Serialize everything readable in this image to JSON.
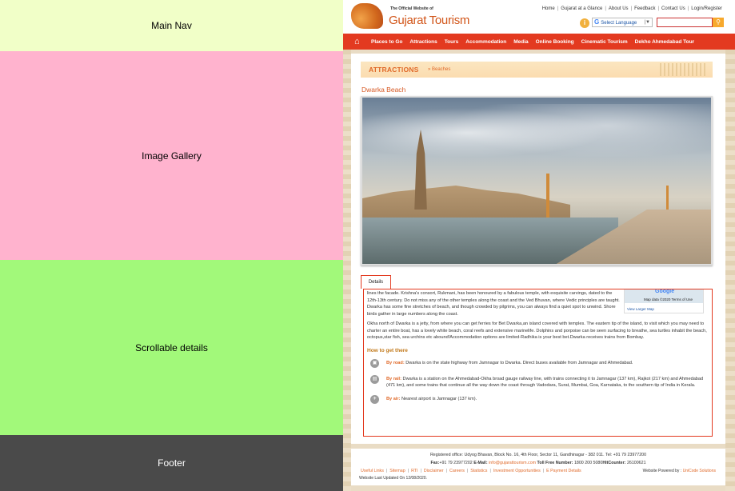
{
  "annotations": {
    "main_nav": "Main Nav",
    "image_gallery": "Image Gallery",
    "scrollable_details": "Scrollable details",
    "footer": "Footer"
  },
  "header": {
    "logo_small": "The Official Website of",
    "logo_big": "Gujarat Tourism",
    "top_links": [
      "Home",
      "Gujarat at a Glance",
      "About Us",
      "Feedback",
      "Contact Us",
      "Login/Register"
    ],
    "language_label": "Select Language",
    "search_placeholder": ""
  },
  "nav": {
    "items": [
      "Places to Go",
      "Attractions",
      "Tours",
      "Accommodation",
      "Media",
      "Online Booking",
      "Cinematic Tourism",
      "Dekho Ahmedabad Tour"
    ]
  },
  "breadcrumb": {
    "title": "ATTRACTIONS",
    "sub": "» Beaches"
  },
  "page": {
    "title": "Dwarka Beach",
    "tab": "Details"
  },
  "map": {
    "brand": "Google",
    "data_text": "Map data ©2020   Terms of Use",
    "larger_link": "View Larger Map"
  },
  "details": {
    "para1": "lines the facade. Krishna's consort, Rukmani, has been honoured by a fabulous temple, with exquisite carvings, dated to the 12th-13th century. Do not miss any of the other temples along the coast and the Ved Bhuvan, where Vedic principles are taught. Dwarka has some fine stretches of beach, and though crowded by pilgrims, you can always find a quiet spot to unwind. Shore birds gather in large numbers along the coast.",
    "para2": "Okha north of Dwarka is a jetty, from where you can get ferries for Bet Dwarka,an island covered with temples. The eastern tip of the island, to visit which you may need to charter an entire boat, has a lovely white beach, coral reefs and extensive marinelife. Dolphins and porpoise can be seen surfacing to breathe, sea turtles inhabit the beach, octopus,star fish, sea urchins etc abound!Accommodation options are limited-Radhika is your best bet.Dwarka receives trains from Bombay.",
    "how_title": "How to get there",
    "ways": [
      {
        "label": "By road:",
        "text": "Dwarka is on the state highway from Jamnagar to Dwarka. Direct buses available from Jamnagar and Ahmedabad."
      },
      {
        "label": "By rail:",
        "text": "Dwarka is a station on the Ahmedabad-Okha broad gauge railway line, with trains connecting it to Jamnagar (137 km), Rajkot (217 km) and Ahmedabad (471 km), and some trains that continue all the way down the coast through Vadodara, Surat, Mumbai, Goa, Karnataka, to the southern tip of India in Kerala."
      },
      {
        "label": "By air:",
        "text": "Nearest airport is Jamnagar (137 km)."
      }
    ]
  },
  "footer": {
    "office": "Registered office: Udyog Bhavan, Block No. 16, 4th Floor, Sector 11, Gandhinagar - 382 011. Tel: +91 79 23977200",
    "fax_label": "Fax:",
    "fax": "+91 79 23977202",
    "email_label": "E-Mail:",
    "email": "info@gujarattourism.com",
    "tollfree_label": "Toll Free Number:",
    "tollfree": "1800 200 5080",
    "hitcounter_label": "HitCounter:",
    "hitcounter": "26100621",
    "links": [
      "Useful Links",
      "Sitemap",
      "RTI",
      "Disclaimer",
      "Careers",
      "Statistics",
      "Investment Opportunities",
      "E Payment Details"
    ],
    "powered_label": "Website Powered by :",
    "powered_by": "UniCode Solutions",
    "updated": "Website Last Updated On 12/08/2020."
  }
}
